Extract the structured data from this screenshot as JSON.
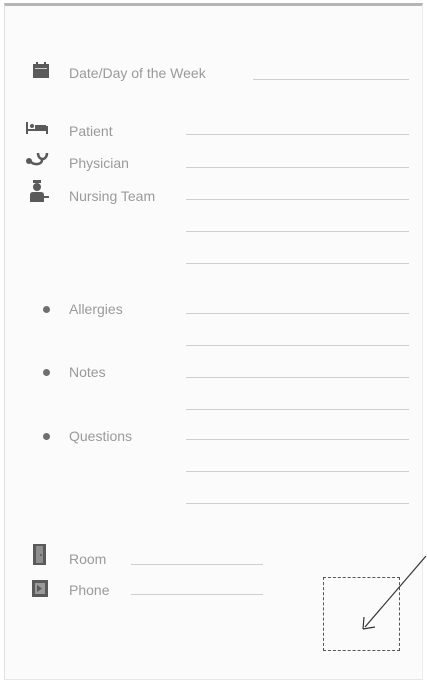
{
  "form": {
    "date_label": "Date/Day of the Week",
    "patient_label": "Patient",
    "physician_label": "Physician",
    "nursing_label": "Nursing Team",
    "allergies_label": "Allergies",
    "notes_label": "Notes",
    "questions_label": "Questions",
    "room_label": "Room",
    "phone_label": "Phone"
  },
  "icons": {
    "date": "calendar-icon",
    "patient": "bed-icon",
    "physician": "stethoscope-icon",
    "nursing": "nurse-icon",
    "room": "door-icon",
    "phone": "phone-icon"
  },
  "colors": {
    "label": "#9a9a9a",
    "icon": "#5a5a5a",
    "line": "#cfcfcf"
  }
}
